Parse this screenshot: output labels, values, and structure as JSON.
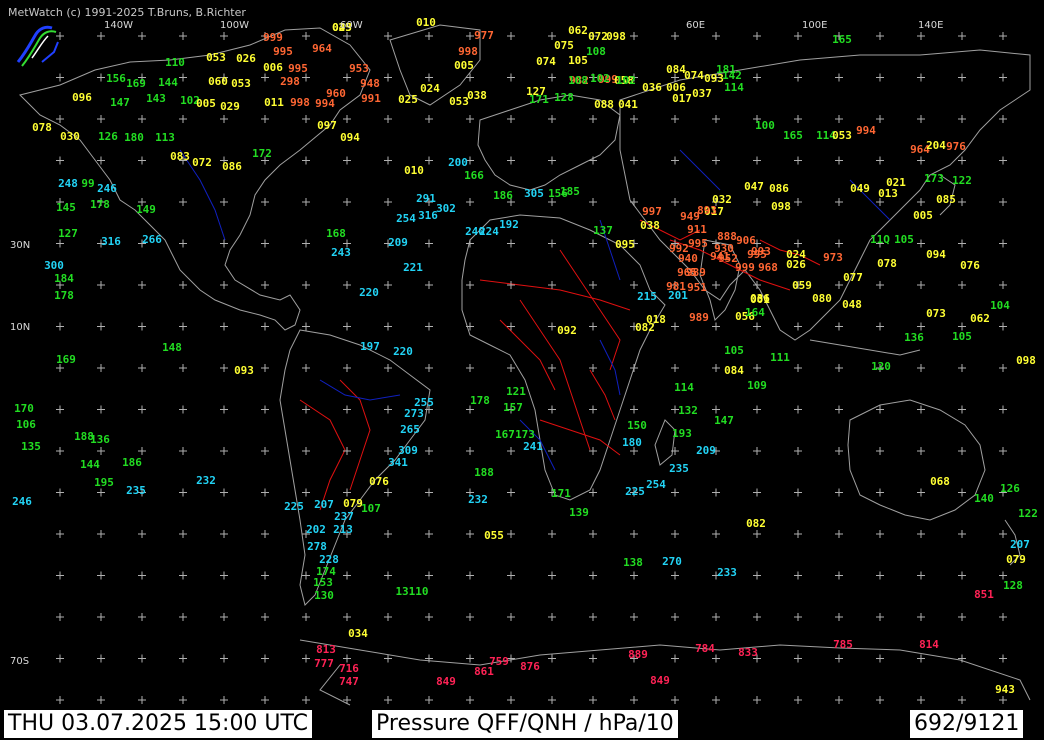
{
  "copyright": "MetWatch (c) 1991-2025 T.Bruns, B.Richter",
  "footer": {
    "datetime": "THU 03.07.2025 15:00 UTC",
    "parameter": "Pressure QFF/QNH / hPa/10",
    "count": "692/9121"
  },
  "lon_labels": [
    "140W",
    "100W",
    "60W",
    "60E",
    "100E",
    "140E"
  ],
  "lat_labels": [
    "30N",
    "10N",
    "70S"
  ],
  "colors": {
    "background": "#000000",
    "coast": "#a0a0a0",
    "borders": "#e01010",
    "rivers": "#1020c0",
    "grid": "#b0b0b0",
    "very_high": "#22d3f5",
    "high": "#22dd22",
    "normal": "#ffff33",
    "low": "#ff6633",
    "very_low": "#ff2255"
  },
  "logo_icon": "metwatch-logo-icon",
  "observations": [
    [
      "025",
      "y"
    ],
    [
      "010",
      "y"
    ],
    [
      "977",
      "r"
    ],
    [
      "062",
      "y"
    ],
    [
      "072",
      "y"
    ],
    [
      "098",
      "y"
    ],
    [
      "999",
      "r"
    ],
    [
      "964",
      "r"
    ],
    [
      "995",
      "r"
    ],
    [
      "998",
      "r"
    ],
    [
      "075",
      "y"
    ],
    [
      "108",
      "g"
    ],
    [
      "165",
      "g"
    ],
    [
      "110",
      "g"
    ],
    [
      "053",
      "y"
    ],
    [
      "026",
      "y"
    ],
    [
      "006",
      "y"
    ],
    [
      "995",
      "r"
    ],
    [
      "953",
      "r"
    ],
    [
      "005",
      "y"
    ],
    [
      "074",
      "y"
    ],
    [
      "105",
      "y"
    ],
    [
      "084",
      "y"
    ],
    [
      "181",
      "g"
    ],
    [
      "982",
      "r"
    ],
    [
      "999",
      "r"
    ],
    [
      "058",
      "y"
    ],
    [
      "127",
      "y"
    ],
    [
      "108",
      "g"
    ],
    [
      "102",
      "g"
    ],
    [
      "102",
      "g"
    ],
    [
      "074",
      "y"
    ],
    [
      "093",
      "y"
    ],
    [
      "142",
      "g"
    ],
    [
      "156",
      "g"
    ],
    [
      "169",
      "g"
    ],
    [
      "144",
      "g"
    ],
    [
      "060",
      "y"
    ],
    [
      "053",
      "y"
    ],
    [
      "298",
      "r"
    ],
    [
      "948",
      "r"
    ],
    [
      "024",
      "y"
    ],
    [
      "036",
      "y"
    ],
    [
      "006",
      "y"
    ],
    [
      "114",
      "g"
    ],
    [
      "096",
      "y"
    ],
    [
      "147",
      "g"
    ],
    [
      "143",
      "g"
    ],
    [
      "102",
      "g"
    ],
    [
      "005",
      "y"
    ],
    [
      "029",
      "y"
    ],
    [
      "011",
      "y"
    ],
    [
      "998",
      "r"
    ],
    [
      "994",
      "r"
    ],
    [
      "960",
      "r"
    ],
    [
      "991",
      "r"
    ],
    [
      "025",
      "y"
    ],
    [
      "053",
      "y"
    ],
    [
      "038",
      "y"
    ],
    [
      "171",
      "g"
    ],
    [
      "128",
      "g"
    ],
    [
      "088",
      "y"
    ],
    [
      "041",
      "y"
    ],
    [
      "017",
      "y"
    ],
    [
      "037",
      "y"
    ],
    [
      "078",
      "y"
    ],
    [
      "030",
      "y"
    ],
    [
      "126",
      "g"
    ],
    [
      "180",
      "g"
    ],
    [
      "113",
      "g"
    ],
    [
      "097",
      "y"
    ],
    [
      "094",
      "y"
    ],
    [
      "100",
      "g"
    ],
    [
      "165",
      "g"
    ],
    [
      "114",
      "g"
    ],
    [
      "053",
      "y"
    ],
    [
      "994",
      "r"
    ],
    [
      "964",
      "r"
    ],
    [
      "204",
      "y"
    ],
    [
      "976",
      "r"
    ],
    [
      "083",
      "y"
    ],
    [
      "072",
      "y"
    ],
    [
      "086",
      "y"
    ],
    [
      "172",
      "g"
    ],
    [
      "010",
      "y"
    ],
    [
      "200",
      "c"
    ],
    [
      "291",
      "c"
    ],
    [
      "302",
      "c"
    ],
    [
      "316",
      "c"
    ],
    [
      "254",
      "c"
    ],
    [
      "240",
      "c"
    ],
    [
      "224",
      "c"
    ],
    [
      "192",
      "c"
    ],
    [
      "166",
      "g"
    ],
    [
      "186",
      "g"
    ],
    [
      "305",
      "c"
    ],
    [
      "156",
      "g"
    ],
    [
      "185",
      "g"
    ],
    [
      "137",
      "g"
    ],
    [
      "095",
      "y"
    ],
    [
      "038",
      "y"
    ],
    [
      "992",
      "r"
    ],
    [
      "995",
      "r"
    ],
    [
      "911",
      "r"
    ],
    [
      "888",
      "r"
    ],
    [
      "906",
      "r"
    ],
    [
      "930",
      "r"
    ],
    [
      "993",
      "r"
    ],
    [
      "952",
      "r"
    ],
    [
      "995",
      "r"
    ],
    [
      "024",
      "y"
    ],
    [
      "026",
      "y"
    ],
    [
      "999",
      "r"
    ],
    [
      "968",
      "r"
    ],
    [
      "973",
      "r"
    ],
    [
      "077",
      "y"
    ],
    [
      "078",
      "y"
    ],
    [
      "092",
      "y"
    ],
    [
      "082",
      "y"
    ],
    [
      "018",
      "y"
    ],
    [
      "989",
      "r"
    ],
    [
      "056",
      "y"
    ],
    [
      "105",
      "g"
    ],
    [
      "111",
      "g"
    ],
    [
      "120",
      "g"
    ],
    [
      "098",
      "y"
    ],
    [
      "084",
      "y"
    ],
    [
      "109",
      "g"
    ],
    [
      "114",
      "g"
    ],
    [
      "132",
      "g"
    ],
    [
      "147",
      "g"
    ],
    [
      "150",
      "g"
    ],
    [
      "180",
      "c"
    ],
    [
      "193",
      "g"
    ],
    [
      "209",
      "c"
    ],
    [
      "235",
      "c"
    ],
    [
      "254",
      "c"
    ],
    [
      "225",
      "c"
    ],
    [
      "139",
      "g"
    ],
    [
      "171",
      "g"
    ],
    [
      "241",
      "c"
    ],
    [
      "232",
      "c"
    ],
    [
      "055",
      "y"
    ],
    [
      "138",
      "g"
    ],
    [
      "270",
      "c"
    ],
    [
      "233",
      "c"
    ],
    [
      "082",
      "y"
    ],
    [
      "13110",
      "g"
    ],
    [
      "034",
      "y"
    ],
    [
      "813",
      "m"
    ],
    [
      "777",
      "m"
    ],
    [
      "716",
      "m"
    ],
    [
      "747",
      "m"
    ],
    [
      "759",
      "m"
    ],
    [
      "861",
      "m"
    ],
    [
      "876",
      "m"
    ],
    [
      "849",
      "m"
    ],
    [
      "889",
      "m"
    ],
    [
      "784",
      "m"
    ],
    [
      "833",
      "m"
    ],
    [
      "785",
      "m"
    ],
    [
      "814",
      "m"
    ],
    [
      "849",
      "m"
    ],
    [
      "943",
      "y"
    ],
    [
      "851",
      "m"
    ],
    [
      "128",
      "g"
    ],
    [
      "207",
      "c"
    ],
    [
      "079",
      "y"
    ],
    [
      "122",
      "g"
    ],
    [
      "126",
      "g"
    ],
    [
      "140",
      "g"
    ],
    [
      "068",
      "y"
    ],
    [
      "170",
      "g"
    ],
    [
      "106",
      "g"
    ],
    [
      "135",
      "g"
    ],
    [
      "188",
      "g"
    ],
    [
      "136",
      "g"
    ],
    [
      "144",
      "g"
    ],
    [
      "186",
      "g"
    ],
    [
      "195",
      "g"
    ],
    [
      "235",
      "c"
    ],
    [
      "232",
      "c"
    ],
    [
      "246",
      "c"
    ],
    [
      "127",
      "g"
    ],
    [
      "316",
      "c"
    ],
    [
      "266",
      "c"
    ],
    [
      "300",
      "c"
    ],
    [
      "184",
      "g"
    ],
    [
      "178",
      "g"
    ],
    [
      "169",
      "g"
    ],
    [
      "148",
      "g"
    ],
    [
      "093",
      "y"
    ],
    [
      "145",
      "g"
    ],
    [
      "178",
      "g"
    ],
    [
      "246",
      "c"
    ],
    [
      "248",
      "c"
    ],
    [
      "99",
      "g"
    ],
    [
      "149",
      "g"
    ],
    [
      "168",
      "g"
    ],
    [
      "209",
      "c"
    ],
    [
      "221",
      "c"
    ],
    [
      "243",
      "c"
    ],
    [
      "220",
      "c"
    ],
    [
      "225",
      "c"
    ],
    [
      "207",
      "c"
    ],
    [
      "202",
      "c"
    ],
    [
      "237",
      "c"
    ],
    [
      "213",
      "c"
    ],
    [
      "278",
      "c"
    ],
    [
      "228",
      "c"
    ],
    [
      "174",
      "g"
    ],
    [
      "153",
      "g"
    ],
    [
      "130",
      "g"
    ],
    [
      "107",
      "g"
    ],
    [
      "079",
      "y"
    ],
    [
      "076",
      "y"
    ],
    [
      "341",
      "c"
    ],
    [
      "309",
      "c"
    ],
    [
      "265",
      "c"
    ],
    [
      "273",
      "c"
    ],
    [
      "255",
      "c"
    ],
    [
      "220",
      "c"
    ],
    [
      "197",
      "c"
    ],
    [
      "178",
      "g"
    ],
    [
      "121",
      "g"
    ],
    [
      "157",
      "g"
    ],
    [
      "167",
      "g"
    ],
    [
      "173",
      "g"
    ],
    [
      "188",
      "g"
    ],
    [
      "215",
      "c"
    ],
    [
      "201",
      "c"
    ],
    [
      "164",
      "g"
    ],
    [
      "036",
      "y"
    ],
    [
      "001",
      "y"
    ],
    [
      "059",
      "y"
    ],
    [
      "080",
      "y"
    ],
    [
      "048",
      "y"
    ],
    [
      "094",
      "y"
    ],
    [
      "076",
      "y"
    ],
    [
      "073",
      "y"
    ],
    [
      "062",
      "y"
    ],
    [
      "136",
      "g"
    ],
    [
      "105",
      "g"
    ],
    [
      "104",
      "g"
    ],
    [
      "11Q",
      "g"
    ],
    [
      "105",
      "g"
    ],
    [
      "085",
      "y"
    ],
    [
      "122",
      "g"
    ],
    [
      "173",
      "g"
    ],
    [
      "021",
      "y"
    ],
    [
      "013",
      "y"
    ],
    [
      "005",
      "y"
    ],
    [
      "049",
      "y"
    ],
    [
      "098",
      "y"
    ],
    [
      "047",
      "y"
    ],
    [
      "086",
      "y"
    ],
    [
      "032",
      "y"
    ],
    [
      "017",
      "y"
    ],
    [
      "997",
      "r"
    ],
    [
      "949",
      "r"
    ],
    [
      "965",
      "r"
    ],
    [
      "941",
      "r"
    ],
    [
      "989",
      "r"
    ],
    [
      "940",
      "r"
    ],
    [
      "951",
      "r"
    ],
    [
      "981",
      "r"
    ],
    [
      "893",
      "r"
    ],
    [
      "043",
      "y"
    ]
  ]
}
